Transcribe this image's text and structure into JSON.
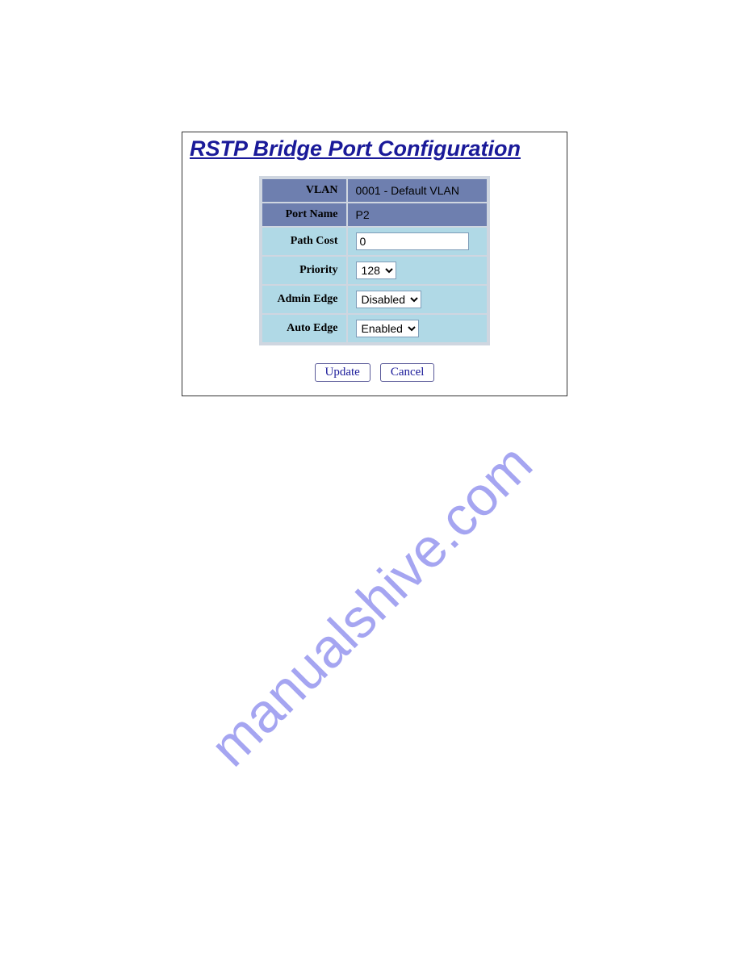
{
  "title": "RSTP Bridge Port Configuration",
  "rows": {
    "vlan": {
      "label": "VLAN",
      "value": "0001 - Default VLAN"
    },
    "port_name": {
      "label": "Port Name",
      "value": "P2"
    },
    "path_cost": {
      "label": "Path Cost",
      "value": "0"
    },
    "priority": {
      "label": "Priority",
      "value": "128"
    },
    "admin_edge": {
      "label": "Admin Edge",
      "value": "Disabled"
    },
    "auto_edge": {
      "label": "Auto Edge",
      "value": "Enabled"
    }
  },
  "buttons": {
    "update": "Update",
    "cancel": "Cancel"
  },
  "watermark": "manualshive.com"
}
